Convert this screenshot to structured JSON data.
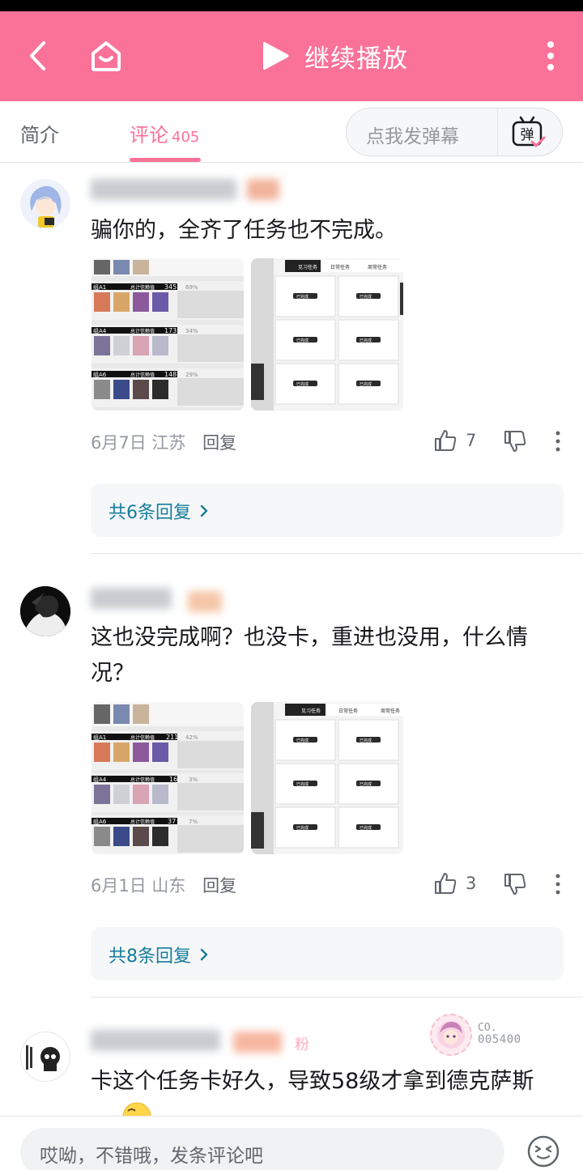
{
  "header": {
    "play_label": "继续播放"
  },
  "tabs": {
    "intro": "简介",
    "comments": "评论",
    "comment_count": "405",
    "danmaku_placeholder": "点我发弹幕",
    "danmaku_button": "弹"
  },
  "comments": [
    {
      "text": "骗你的，全齐了任务也不完成。",
      "date": "6月7日",
      "location": "江苏",
      "reply_label": "回复",
      "likes": "7",
      "replies_summary": "共6条回复"
    },
    {
      "text": "这也没完成啊？也没卡，重进也没用，什么情况？",
      "date": "6月1日",
      "location": "山东",
      "reply_label": "回复",
      "likes": "3",
      "replies_summary": "共8条回复"
    },
    {
      "text": "卡这个任务卡好久，导致58级才拿到德克萨斯",
      "badge_line1": "CO.",
      "badge_line2": "005400",
      "name_suffix": "粉"
    }
  ],
  "thumbnails": {
    "left_a": {
      "counts": [
        "345",
        "173",
        "148"
      ],
      "percents": [
        "69%",
        "34%",
        "29%"
      ],
      "label_prefix": [
        "组A1",
        "组A4",
        "组A6"
      ],
      "stat_label": "总计信赖值"
    },
    "left_b": {
      "counts": [
        "211",
        "16",
        "37"
      ],
      "percents": [
        "42%",
        "3%",
        "7%"
      ],
      "label_prefix": [
        "组A1",
        "组A4",
        "组A6"
      ],
      "stat_label": "总计信赖值"
    },
    "right": {
      "tabs": [
        "见习任务",
        "日常任务",
        "周常任务"
      ],
      "cell_label": "已完成"
    }
  },
  "composer": {
    "placeholder": "哎呦，不错哦，发条评论吧"
  },
  "colors": {
    "brand_pink": "#fb7299",
    "link_blue": "#167d9c",
    "muted_text": "#9499a0"
  },
  "icons": [
    "back-icon",
    "home-icon",
    "play-icon",
    "more-vertical-icon",
    "danmaku-icon",
    "thumb-up-icon",
    "thumb-down-icon",
    "chevron-right-icon",
    "emoji-icon"
  ]
}
